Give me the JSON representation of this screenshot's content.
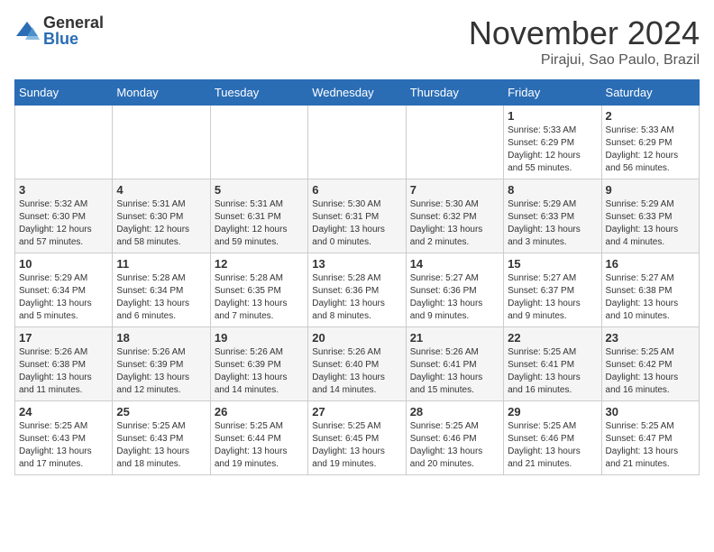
{
  "header": {
    "logo_general": "General",
    "logo_blue": "Blue",
    "month_title": "November 2024",
    "location": "Pirajui, Sao Paulo, Brazil"
  },
  "calendar": {
    "days_of_week": [
      "Sunday",
      "Monday",
      "Tuesday",
      "Wednesday",
      "Thursday",
      "Friday",
      "Saturday"
    ],
    "weeks": [
      [
        {
          "day": "",
          "info": ""
        },
        {
          "day": "",
          "info": ""
        },
        {
          "day": "",
          "info": ""
        },
        {
          "day": "",
          "info": ""
        },
        {
          "day": "",
          "info": ""
        },
        {
          "day": "1",
          "info": "Sunrise: 5:33 AM\nSunset: 6:29 PM\nDaylight: 12 hours\nand 55 minutes."
        },
        {
          "day": "2",
          "info": "Sunrise: 5:33 AM\nSunset: 6:29 PM\nDaylight: 12 hours\nand 56 minutes."
        }
      ],
      [
        {
          "day": "3",
          "info": "Sunrise: 5:32 AM\nSunset: 6:30 PM\nDaylight: 12 hours\nand 57 minutes."
        },
        {
          "day": "4",
          "info": "Sunrise: 5:31 AM\nSunset: 6:30 PM\nDaylight: 12 hours\nand 58 minutes."
        },
        {
          "day": "5",
          "info": "Sunrise: 5:31 AM\nSunset: 6:31 PM\nDaylight: 12 hours\nand 59 minutes."
        },
        {
          "day": "6",
          "info": "Sunrise: 5:30 AM\nSunset: 6:31 PM\nDaylight: 13 hours\nand 0 minutes."
        },
        {
          "day": "7",
          "info": "Sunrise: 5:30 AM\nSunset: 6:32 PM\nDaylight: 13 hours\nand 2 minutes."
        },
        {
          "day": "8",
          "info": "Sunrise: 5:29 AM\nSunset: 6:33 PM\nDaylight: 13 hours\nand 3 minutes."
        },
        {
          "day": "9",
          "info": "Sunrise: 5:29 AM\nSunset: 6:33 PM\nDaylight: 13 hours\nand 4 minutes."
        }
      ],
      [
        {
          "day": "10",
          "info": "Sunrise: 5:29 AM\nSunset: 6:34 PM\nDaylight: 13 hours\nand 5 minutes."
        },
        {
          "day": "11",
          "info": "Sunrise: 5:28 AM\nSunset: 6:34 PM\nDaylight: 13 hours\nand 6 minutes."
        },
        {
          "day": "12",
          "info": "Sunrise: 5:28 AM\nSunset: 6:35 PM\nDaylight: 13 hours\nand 7 minutes."
        },
        {
          "day": "13",
          "info": "Sunrise: 5:28 AM\nSunset: 6:36 PM\nDaylight: 13 hours\nand 8 minutes."
        },
        {
          "day": "14",
          "info": "Sunrise: 5:27 AM\nSunset: 6:36 PM\nDaylight: 13 hours\nand 9 minutes."
        },
        {
          "day": "15",
          "info": "Sunrise: 5:27 AM\nSunset: 6:37 PM\nDaylight: 13 hours\nand 9 minutes."
        },
        {
          "day": "16",
          "info": "Sunrise: 5:27 AM\nSunset: 6:38 PM\nDaylight: 13 hours\nand 10 minutes."
        }
      ],
      [
        {
          "day": "17",
          "info": "Sunrise: 5:26 AM\nSunset: 6:38 PM\nDaylight: 13 hours\nand 11 minutes."
        },
        {
          "day": "18",
          "info": "Sunrise: 5:26 AM\nSunset: 6:39 PM\nDaylight: 13 hours\nand 12 minutes."
        },
        {
          "day": "19",
          "info": "Sunrise: 5:26 AM\nSunset: 6:39 PM\nDaylight: 13 hours\nand 14 minutes."
        },
        {
          "day": "20",
          "info": "Sunrise: 5:26 AM\nSunset: 6:40 PM\nDaylight: 13 hours\nand 14 minutes."
        },
        {
          "day": "21",
          "info": "Sunrise: 5:26 AM\nSunset: 6:41 PM\nDaylight: 13 hours\nand 15 minutes."
        },
        {
          "day": "22",
          "info": "Sunrise: 5:25 AM\nSunset: 6:41 PM\nDaylight: 13 hours\nand 16 minutes."
        },
        {
          "day": "23",
          "info": "Sunrise: 5:25 AM\nSunset: 6:42 PM\nDaylight: 13 hours\nand 16 minutes."
        }
      ],
      [
        {
          "day": "24",
          "info": "Sunrise: 5:25 AM\nSunset: 6:43 PM\nDaylight: 13 hours\nand 17 minutes."
        },
        {
          "day": "25",
          "info": "Sunrise: 5:25 AM\nSunset: 6:43 PM\nDaylight: 13 hours\nand 18 minutes."
        },
        {
          "day": "26",
          "info": "Sunrise: 5:25 AM\nSunset: 6:44 PM\nDaylight: 13 hours\nand 19 minutes."
        },
        {
          "day": "27",
          "info": "Sunrise: 5:25 AM\nSunset: 6:45 PM\nDaylight: 13 hours\nand 19 minutes."
        },
        {
          "day": "28",
          "info": "Sunrise: 5:25 AM\nSunset: 6:46 PM\nDaylight: 13 hours\nand 20 minutes."
        },
        {
          "day": "29",
          "info": "Sunrise: 5:25 AM\nSunset: 6:46 PM\nDaylight: 13 hours\nand 21 minutes."
        },
        {
          "day": "30",
          "info": "Sunrise: 5:25 AM\nSunset: 6:47 PM\nDaylight: 13 hours\nand 21 minutes."
        }
      ]
    ]
  }
}
